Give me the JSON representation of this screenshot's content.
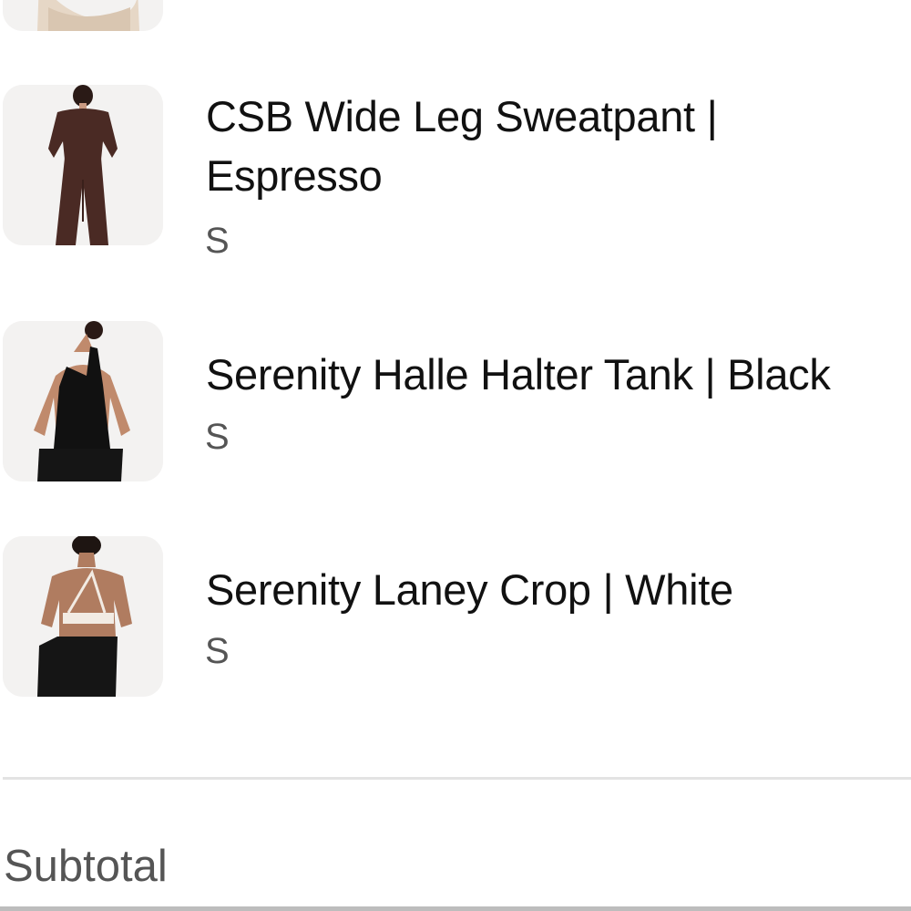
{
  "cart": {
    "items": [
      {
        "title": "",
        "variant": "",
        "thumb_icon": "beige-loungewear-thumbnail-icon"
      },
      {
        "title": "CSB Wide Leg Sweatpant | Espresso",
        "variant": "S",
        "thumb_icon": "espresso-sweatpant-thumbnail-icon",
        "garment_color": "#4a2a24"
      },
      {
        "title": "Serenity Halle Halter Tank | Black",
        "variant": "S",
        "thumb_icon": "black-halter-tank-thumbnail-icon",
        "garment_color": "#111111"
      },
      {
        "title": "Serenity Laney Crop | White",
        "variant": "S",
        "thumb_icon": "white-crop-top-thumbnail-icon",
        "garment_color": "#f2ebe3"
      }
    ]
  },
  "summary": {
    "subtotal_label": "Subtotal"
  },
  "colors": {
    "background": "#ffffff",
    "text_primary": "#111111",
    "text_secondary": "#555555",
    "divider": "#e3e3e3",
    "thumb_bg": "#f3f2f1"
  }
}
